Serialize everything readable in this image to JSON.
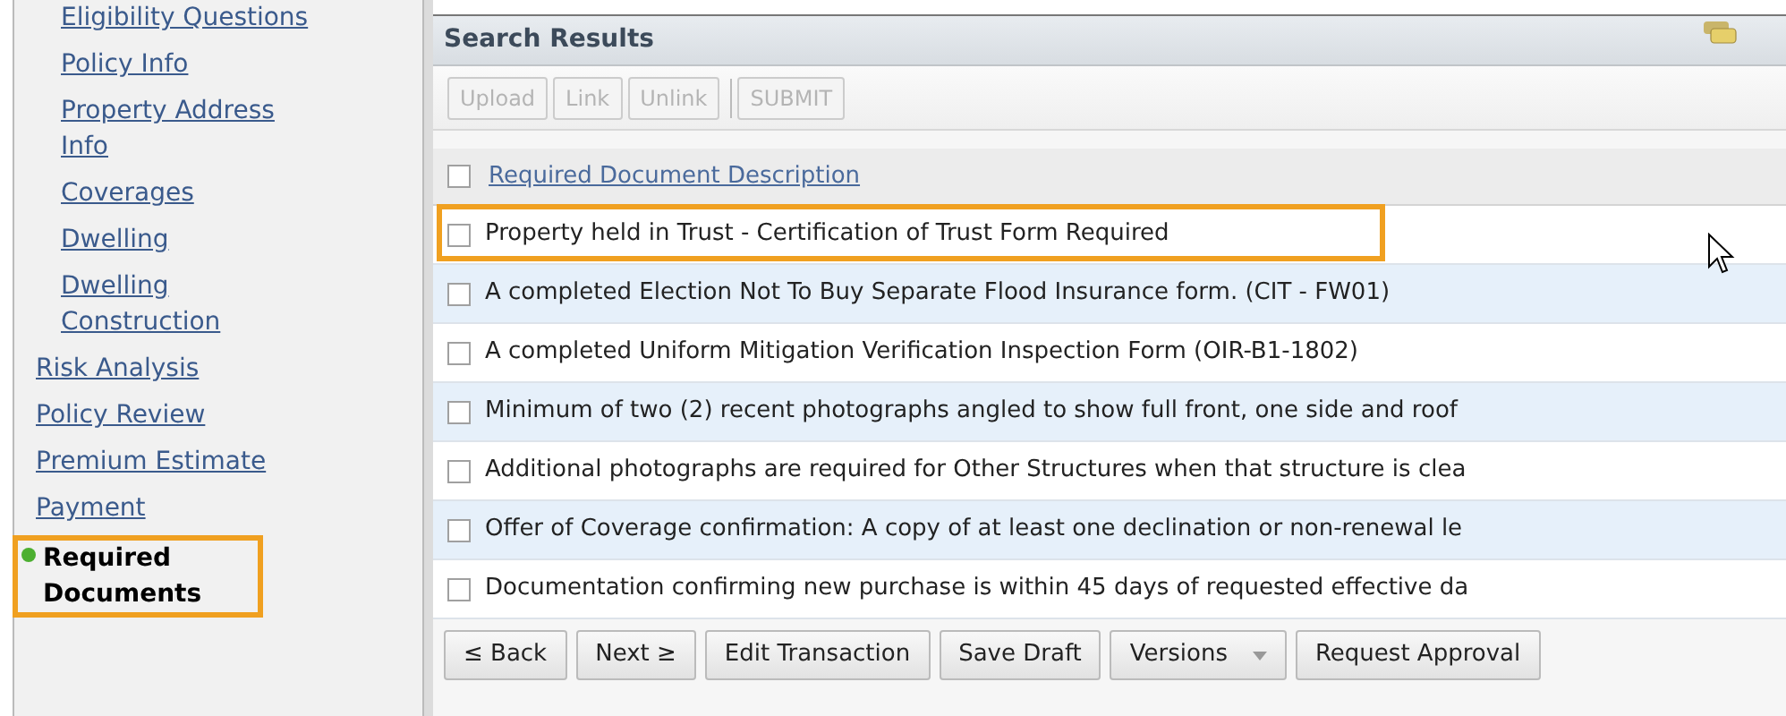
{
  "sidebar": {
    "sub_items": [
      {
        "label": "Eligibility Questions",
        "selected": false
      },
      {
        "label": "Policy Info",
        "selected": false
      },
      {
        "label": "Property Address Info",
        "selected": false
      },
      {
        "label": "Coverages",
        "selected": false
      },
      {
        "label": "Dwelling",
        "selected": false
      },
      {
        "label": "Dwelling Construction",
        "selected": false
      }
    ],
    "items": [
      {
        "label": "Risk Analysis",
        "selected": false,
        "highlighted": false
      },
      {
        "label": "Policy Review",
        "selected": false,
        "highlighted": false
      },
      {
        "label": "Premium Estimate",
        "selected": false,
        "highlighted": false
      },
      {
        "label": "Payment",
        "selected": false,
        "highlighted": false
      },
      {
        "label": "Required Documents",
        "selected": true,
        "highlighted": true
      }
    ]
  },
  "panel": {
    "title": "Search Results",
    "toolbar": [
      {
        "label": "Upload",
        "disabled": true
      },
      {
        "label": "Link",
        "disabled": true
      },
      {
        "label": "Unlink",
        "disabled": true
      },
      {
        "label": "SUBMIT",
        "disabled": true
      }
    ],
    "table": {
      "columns": [
        "Required Document Description"
      ],
      "header_checked": false,
      "rows": [
        {
          "text": "Property held in Trust - Certification of Trust Form Required",
          "checked": false,
          "highlighted": true
        },
        {
          "text": "A completed Election Not To Buy Separate Flood Insurance form. (CIT - FW01)",
          "checked": false,
          "highlighted": false
        },
        {
          "text": "A completed Uniform Mitigation Verification Inspection Form (OIR-B1-1802)",
          "checked": false,
          "highlighted": false
        },
        {
          "text": "Minimum of two (2) recent photographs angled to show full front, one side and roof",
          "checked": false,
          "highlighted": false
        },
        {
          "text": "Additional photographs are required for Other Structures when that structure is clea",
          "checked": false,
          "highlighted": false
        },
        {
          "text": "Offer of Coverage confirmation: A copy of at least one declination or non-renewal le",
          "checked": false,
          "highlighted": false
        },
        {
          "text": "Documentation confirming new purchase is within 45 days of requested effective da",
          "checked": false,
          "highlighted": false
        }
      ]
    },
    "buttons": [
      {
        "label": "≤ Back",
        "kind": "plain"
      },
      {
        "label": "Next ≥",
        "kind": "plain"
      },
      {
        "label": "Edit Transaction",
        "kind": "plain"
      },
      {
        "label": "Save Draft",
        "kind": "plain"
      },
      {
        "label": "Versions",
        "kind": "dropdown"
      },
      {
        "label": "Request Approval",
        "kind": "plain"
      }
    ]
  }
}
